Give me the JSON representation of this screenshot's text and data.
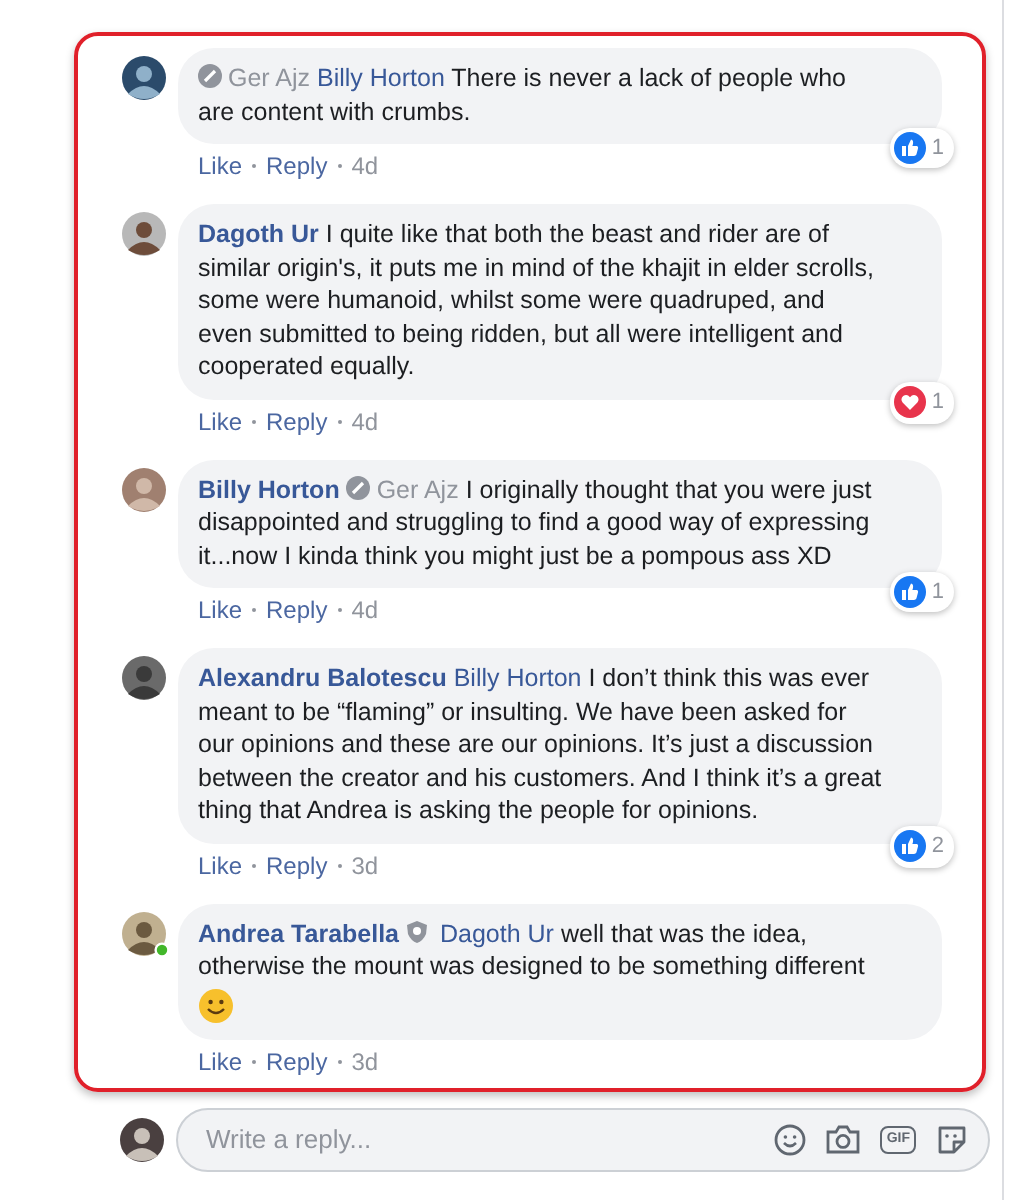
{
  "comments": [
    {
      "author": {
        "name": "Ger Ajz",
        "muted": true
      },
      "admin": false,
      "online": false,
      "mention": {
        "name": "Billy Horton",
        "muted": false
      },
      "text": "There is never a lack of people who are content with crumbs.",
      "emoji": false,
      "reaction": {
        "kind": "like",
        "count": "1"
      },
      "actions": [
        "Like",
        "Reply"
      ],
      "time": "4d"
    },
    {
      "author": {
        "name": "Dagoth Ur",
        "muted": false
      },
      "admin": false,
      "online": false,
      "text": "I quite like that both the beast and rider are of similar origin's, it puts me in mind of the khajit in elder scrolls, some were humanoid, whilst some were quadruped, and even submitted to being ridden, but all were intelligent and cooperated equally.",
      "emoji": false,
      "reaction": {
        "kind": "love",
        "count": "1"
      },
      "actions": [
        "Like",
        "Reply"
      ],
      "time": "4d"
    },
    {
      "author": {
        "name": "Billy Horton",
        "muted": false
      },
      "admin": false,
      "online": false,
      "mention": {
        "name": "Ger Ajz",
        "muted": true
      },
      "text": "I originally thought that you were just disappointed and struggling to find a good way of expressing it...now I kinda think you might just be a pompous ass XD",
      "emoji": false,
      "reaction": {
        "kind": "like",
        "count": "1"
      },
      "actions": [
        "Like",
        "Reply"
      ],
      "time": "4d"
    },
    {
      "author": {
        "name": "Alexandru Balotescu",
        "muted": false
      },
      "admin": false,
      "online": false,
      "mention": {
        "name": "Billy Horton",
        "muted": false
      },
      "text": "I don’t think this was ever meant to be “flaming” or insulting. We have been asked for our opinions and these are our opinions. It’s just a discussion between the creator and his customers. And I think it’s a great thing that Andrea is asking the people for opinions.",
      "emoji": false,
      "reaction": {
        "kind": "like",
        "count": "2"
      },
      "actions": [
        "Like",
        "Reply"
      ],
      "time": "3d"
    },
    {
      "author": {
        "name": "Andrea Tarabella",
        "muted": false
      },
      "admin": true,
      "online": true,
      "mention": {
        "name": "Dagoth Ur",
        "muted": false
      },
      "text": "well that was the idea, otherwise the mount was designed to be something different",
      "emoji": true,
      "actions": [
        "Like",
        "Reply"
      ],
      "time": "3d"
    }
  ],
  "reply_box": {
    "placeholder": "Write a reply...",
    "gif_label": "GIF"
  }
}
